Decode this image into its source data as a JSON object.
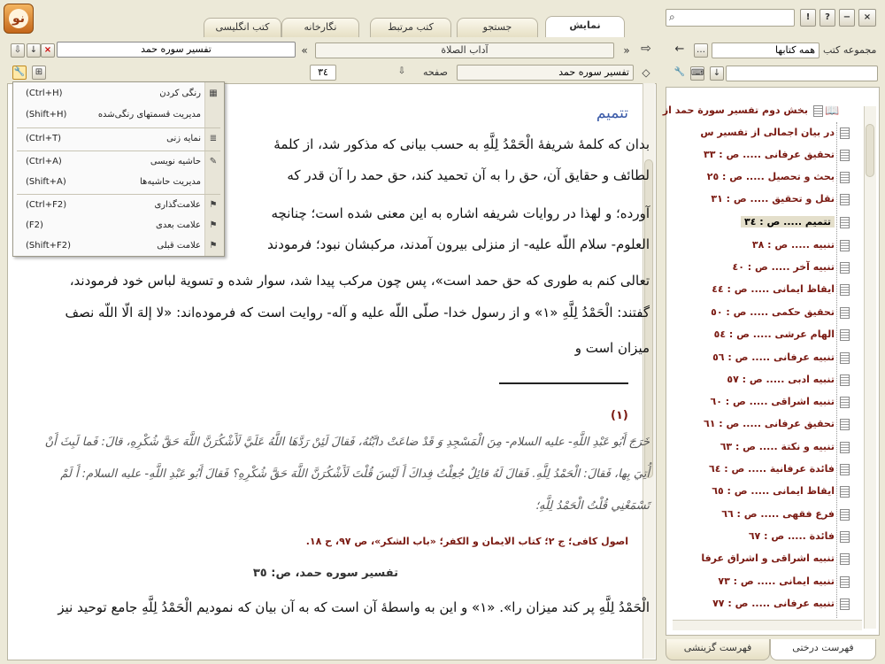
{
  "tabs": {
    "t1": "نمایش",
    "t2": "جستجو",
    "t3": "کتب مرتبط",
    "t4": "نگارخانه",
    "t5": "کتب انگلیسی"
  },
  "window": {
    "help": "?",
    "info": "!",
    "min": "−",
    "max": "□",
    "close": "×"
  },
  "right": {
    "collection_label": "مجموعه کتب",
    "collection_value": "همه کتابها",
    "nav_back": "←",
    "tab_tree": "فهرست درختی",
    "tab_selected": "فهرست گزینشی"
  },
  "toc": [
    "بخش دوم تفسير سورة حمد از",
    "در بيان اجمالى از تفسير س",
    "تحقيق عرفانى ..... ص : ٣٣",
    "بحث و تحصيل ..... ص : ٢٥",
    "نقل و تحقيق ..... ص : ٣١",
    "تتميم ..... ص : ٣٤",
    "تنبيه ..... ص : ٣٨",
    "تنبيه آخر ..... ص : ٤٠",
    "ايقاظ ايمانى ..... ص : ٤٤",
    "تحقيق حكمى ..... ص : ٥٠",
    "الهام عرشى ..... ص : ٥٤",
    "تنبيه عرفانى ..... ص : ٥٦",
    "تنبيه ادبى ..... ص : ٥٧",
    "تنبيه اشراقى ..... ص : ٦٠",
    "تحقيق عرفانى ..... ص : ٦١",
    "تنبيه و نكتة ..... ص : ٦٣",
    "فائدة عرفانية ..... ص : ٦٤",
    "ايقاظ ايمانى ..... ص : ٦٥",
    "فرع فقهى ..... ص : ٦٦",
    "فائدة ..... ص : ٦٧",
    "تنبيه اشراقى و اشراق عرفا",
    "تنبيه ايمانى ..... ص : ٧٣",
    "تنبيه عرفانى ..... ص : ٧٧"
  ],
  "book": {
    "title": "تفسير سوره حمد",
    "other_tab": "آداب الصلاة",
    "page_label": "صفحه",
    "page_value": "٣٤",
    "section_field": "تفسير سوره حمد",
    "nav_arrows": "»",
    "nav_arrows_left": "«",
    "nav_fwd": "⇨"
  },
  "menu": [
    {
      "label": "رنگی کردن",
      "shortcut": "(Ctrl+H)",
      "icon": "▦"
    },
    {
      "label": "مدیریت قسمتهای رنگی‌شده",
      "shortcut": "(Shift+H)",
      "icon": ""
    },
    {
      "label": "نمایه زنی",
      "shortcut": "(Ctrl+T)",
      "icon": "≣"
    },
    {
      "label": "حاشیه نویسی",
      "shortcut": "(Ctrl+A)",
      "icon": "✎"
    },
    {
      "label": "مدیریت حاشیه‌ها",
      "shortcut": "(Shift+A)",
      "icon": ""
    },
    {
      "label": "علامت‌گذاری",
      "shortcut": "(Ctrl+F2)",
      "icon": "⚑"
    },
    {
      "label": "علامت بعدی",
      "shortcut": "(F2)",
      "icon": "⚑"
    },
    {
      "label": "علامت قبلی",
      "shortcut": "(Shift+F2)",
      "icon": "⚑"
    }
  ],
  "content": {
    "heading": "تتميم",
    "l1": "بدان كه كلمۀ شريفۀ الْحَمْدُ لِلَّهِ به حسب بيانى كه مذكور شد، از كلمۀ",
    "l2": "لطائف و حقايق آن، حق را به آن تحميد كند، حق حمد را آن قدر كه",
    "l3": "آورده؛ و لهذا در روايات شريفه اشاره به اين معنى شده است؛ چنانچه",
    "l4": "العلوم- سلام اللّه عليه- از منزلى بيرون آمدند، مركبشان نبود؛ فرمودند",
    "l5": "تعالى كنم به طورى كه حق حمد است»، پس چون مركب پيدا شد، سوار شده و تسوية لباس خود فرمودند،",
    "l6": "گفتند: الْحَمْدُ لِلَّهِ «١» و از رسول خدا- صلّى اللّه عليه و آله- روايت است كه فرموده‌اند: «لا إلهَ الّا اللّه نصف",
    "l7": "ميزان است و",
    "fn_num": "(١)",
    "fn1": "خَرَجَ أَبُو عَبْدِ اللَّهِ- عليه السلام- مِنَ الْمَسْجِدِ وَ قَدْ ضاعَتْ دابَّتُهُ، فَقالَ لَئِنْ رَدَّهَا اللَّهُ عَلَيَّ لَأَشْكُرَنَّ اللَّهَ حَقَّ شُكْرِهِ، قالَ: فَما لَبِثَ أَنْ",
    "fn2": "أُتِيَ بِها، فَقالَ: الْحَمْدُ لِلَّهِ. فَقالَ لَهُ قائِلٌ جُعِلْتُ فِداكَ أَ لَيْسَ قُلْتَ لَأَشْكُرَنَّ اللَّهَ حَقَّ شُكْرِهِ؟ فَقالَ أَبُو عَبْدِ اللَّهِ- عليه السلام: أَ لَمْ",
    "fn3": "تَسْمَعْنِي قُلْتُ الْحَمْدُ لِلَّهِ؛",
    "fn_src": "اصول كافى؛ ج ٢؛ كتاب الايمان و الكفر؛ «باب الشكر»، ص ٩٧، ح ١٨.",
    "pg_header": "تفسير سوره حمد، ص: ٣٥",
    "l8": "الْحَمْدُ لِلَّهِ پر كند ميزان را». «١» و اين به واسطۀ آن است كه به آن بيان كه نموديم الْحَمْدُ لِلَّهِ جامع توحيد نيز"
  }
}
